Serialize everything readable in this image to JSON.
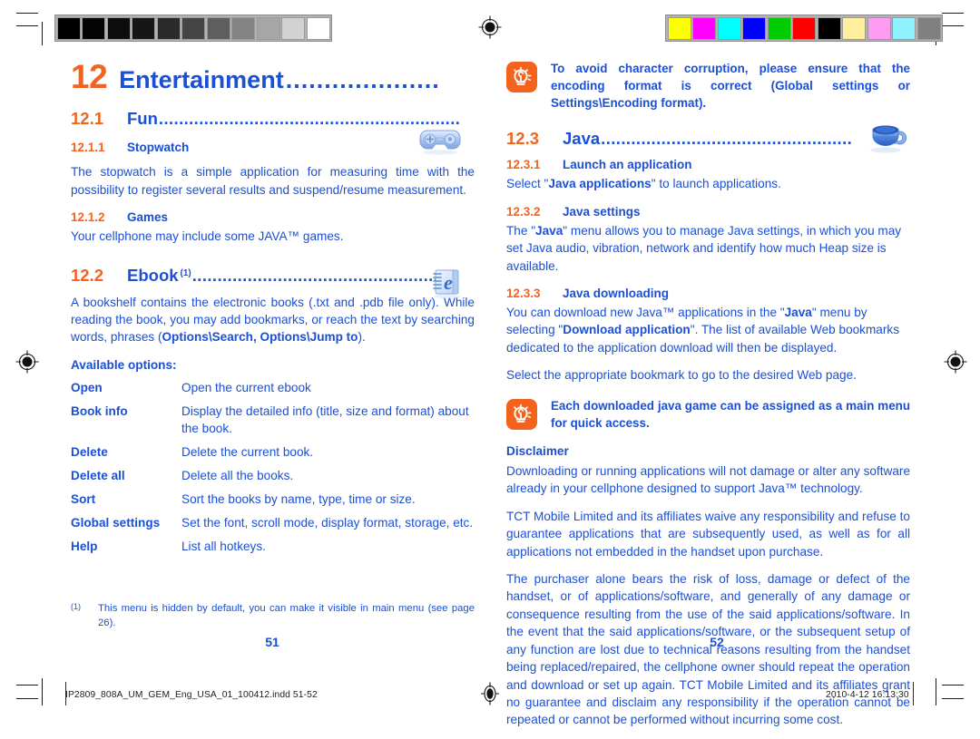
{
  "document": {
    "chapter": {
      "number": "12",
      "title": "Entertainment",
      "dots": "...................."
    },
    "sections": {
      "fun": {
        "num": "12.1",
        "title": "Fun",
        "dots": "............................................................",
        "icon": "gamepad-icon"
      },
      "ebook": {
        "num": "12.2",
        "title": "Ebook",
        "superscript": "(1)",
        "dots": "...................................................",
        "icon": "ebook-icon"
      },
      "java": {
        "num": "12.3",
        "title": "Java",
        "dots": "..................................................",
        "icon": "coffee-cup-icon"
      }
    },
    "subsections": {
      "stopwatch": {
        "num": "12.1.1",
        "title": "Stopwatch"
      },
      "games": {
        "num": "12.1.2",
        "title": "Games"
      },
      "launch_app": {
        "num": "12.3.1",
        "title": "Launch an application"
      },
      "java_settings": {
        "num": "12.3.2",
        "title": "Java settings"
      },
      "java_downloading": {
        "num": "12.3.3",
        "title": "Java downloading"
      }
    },
    "body": {
      "stopwatch_text": "The stopwatch is a simple application for measuring time with the possibility to register several results and suspend/resume measurement.",
      "games_text": "Your cellphone may include some JAVA™ games.",
      "ebook_intro_1": "A bookshelf contains the electronic books (.txt and .pdb file only). While reading the book, you may add bookmarks, or reach the text by searching words, phrases (",
      "ebook_intro_bold": "Options\\Search, Options\\Jump to",
      "ebook_intro_2": ").",
      "available_options_heading": "Available options:",
      "launch_app_1": "Select \"",
      "launch_app_bold": "Java applications",
      "launch_app_2": "\" to launch applications.",
      "java_settings_1": "The \"",
      "java_settings_bold": "Java",
      "java_settings_2": "\" menu allows you to manage Java settings, in which you may set Java audio, vibration, network and identify how much Heap size is available.",
      "java_dl_1": "You can download new Java™ applications in the \"",
      "java_dl_bold1": "Java",
      "java_dl_2": "\" menu by selecting \"",
      "java_dl_bold2": "Download application",
      "java_dl_3": "\". The list of available Web bookmarks dedicated to the application download will then be displayed.",
      "java_dl_4": "Select the appropriate bookmark to go to the desired Web page.",
      "disclaimer_heading": "Disclaimer",
      "disclaimer_p1": "Downloading or running applications will not damage or alter any software already in your cellphone designed to support Java™ technology.",
      "disclaimer_p2": "TCT Mobile Limited and its affiliates waive any responsibility and refuse to guarantee applications that are subsequently used, as well as for all applications not embedded in the handset upon purchase.",
      "disclaimer_p3": "The purchaser alone bears the risk of loss, damage or defect of the handset, or of applications/software, and generally of any damage or consequence resulting from the use of the said applications/software. In the event that the said applications/software, or the subsequent setup of any function are lost due to technical reasons resulting from the handset being replaced/repaired, the cellphone owner should repeat the operation and download or set up again. TCT Mobile Limited and its affiliates grant no guarantee and disclaim any responsibility if the operation cannot be repeated or cannot be performed without incurring some cost."
    },
    "options_table": {
      "rows": [
        {
          "term": "Open",
          "definition": "Open the current ebook"
        },
        {
          "term": "Book info",
          "definition": "Display the detailed info (title, size and format) about the book."
        },
        {
          "term": "Delete",
          "definition": "Delete the current book."
        },
        {
          "term": "Delete all",
          "definition": "Delete all the books."
        },
        {
          "term": "Sort",
          "definition": "Sort the books by name, type, time or size."
        },
        {
          "term": "Global settings",
          "definition": "Set the font, scroll mode, display format, storage, etc."
        },
        {
          "term": "Help",
          "definition": "List all hotkeys."
        }
      ]
    },
    "notes": {
      "encoding": {
        "icon": "tip-bulb-icon",
        "text_1": "To avoid character corruption, please ensure that the encoding format is correct (",
        "bold_1": "Global settings",
        "text_2": " or ",
        "bold_2": "Settings\\Encoding format",
        "text_3": ")."
      },
      "java_game": {
        "icon": "tip-bulb-icon",
        "text": "Each downloaded java game can be assigned as a main menu for quick access."
      }
    },
    "footnote": {
      "mark": "(1)",
      "text": "This menu is hidden by default, you can make it visible in main menu (see page 26)."
    },
    "page_numbers": {
      "left": "51",
      "right": "52"
    },
    "footer": {
      "filename": "IP2809_808A_UM_GEM_Eng_USA_01_100412.indd   51-52",
      "timestamp": "2010-4-12   16:13:30"
    },
    "print_marks": {
      "gray_bar": [
        "#000000",
        "#040404",
        "#0d0d0d",
        "#161616",
        "#2a2a2a",
        "#444444",
        "#5e5e5e",
        "#848484",
        "#a6a6a6",
        "#d2d2d2",
        "#ffffff"
      ],
      "color_bar": [
        "#ffff00",
        "#ff00ff",
        "#00ffff",
        "#0000ff",
        "#00cc00",
        "#ff0000",
        "#000000",
        "#ffef9e",
        "#ff9bf2",
        "#8ff3ff",
        "#808080"
      ]
    },
    "colors": {
      "orange": "#F4631E",
      "blue": "#1A4FD6"
    }
  }
}
